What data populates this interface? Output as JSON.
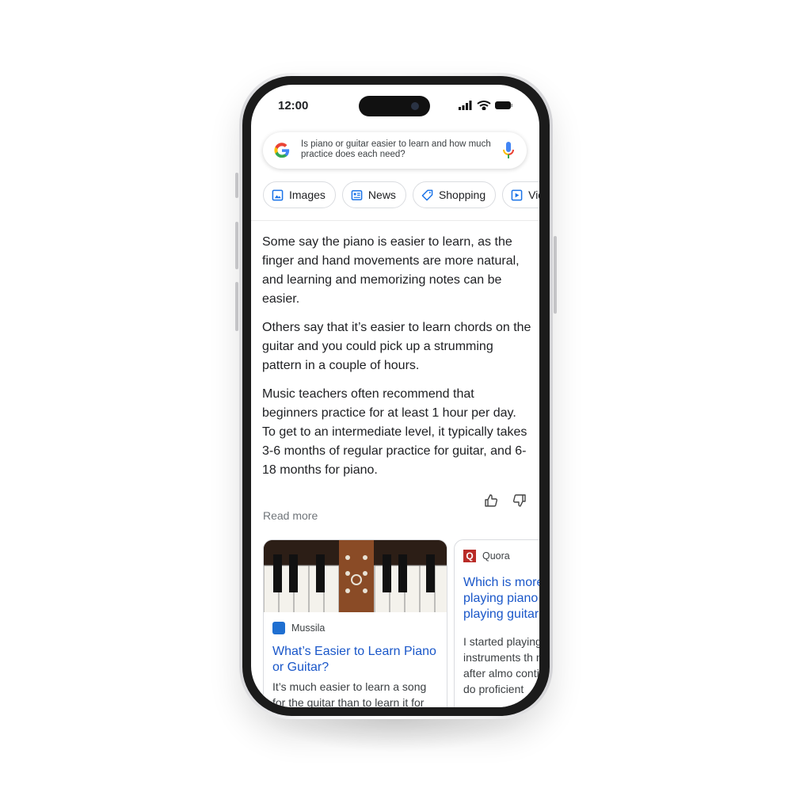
{
  "status_bar": {
    "time": "12:00"
  },
  "search": {
    "query": "Is piano or guitar easier to learn and how much practice does each need?"
  },
  "chips": [
    {
      "label": "Images",
      "icon": "image-icon"
    },
    {
      "label": "News",
      "icon": "news-icon"
    },
    {
      "label": "Shopping",
      "icon": "tag-icon"
    },
    {
      "label": "Videos",
      "icon": "play-icon"
    }
  ],
  "answer": {
    "paragraphs": [
      "Some say the piano is easier to learn, as the finger and hand movements are more natural, and learning and memorizing notes can be easier.",
      "Others say that it’s easier to learn chords on the guitar and you could pick up a strumming pattern in a couple of hours.",
      "Music teachers often recommend that beginners practice for at least 1 hour per day. To get to an intermediate level, it typically takes 3-6 months of regular practice for guitar, and 6-18 months for piano."
    ],
    "read_more": "Read more"
  },
  "cards": [
    {
      "source": "Mussila",
      "title": "What’s Easier to Learn Piano or Guitar?",
      "snippet": "It’s much easier to learn a song for the guitar than to learn it for"
    },
    {
      "source": "Quora",
      "source_letter": "Q",
      "title": "Which is more playing piano playing guitar",
      "snippet": "I started playing instruments th now, after almo continue to do proficient"
    }
  ],
  "colors": {
    "link": "#1a57c9",
    "quora": "#b92b27",
    "chip_icon": "#1a73e8"
  }
}
